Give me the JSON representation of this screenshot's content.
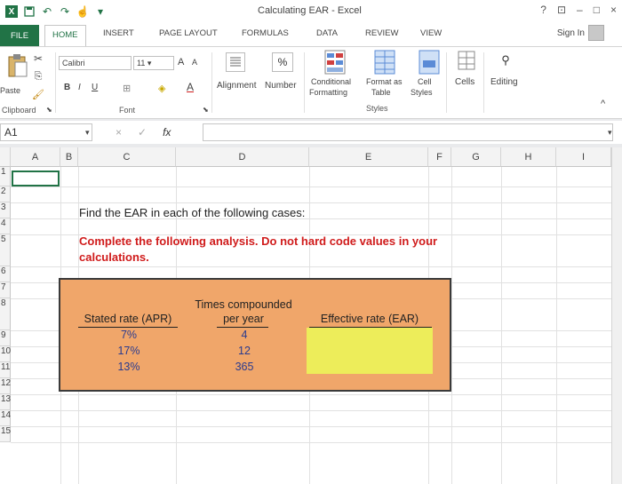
{
  "window": {
    "title": "Calculating EAR - Excel",
    "controls": [
      "?",
      "⊡",
      "–",
      "□",
      "×"
    ],
    "qat_icons": [
      "excel-logo-icon",
      "save-icon",
      "undo-icon",
      "redo-icon",
      "customize-icon"
    ]
  },
  "tabs": [
    "FILE",
    "HOME",
    "INSERT",
    "PAGE LAYOUT",
    "FORMULAS",
    "DATA",
    "REVIEW",
    "VIEW"
  ],
  "sign_in": "Sign In",
  "ribbon": {
    "clipboard": {
      "paste": "Paste",
      "label": "Clipboard"
    },
    "font": {
      "name": "Calibri",
      "size": "11",
      "bold": "B",
      "italic": "I",
      "underline": "U",
      "grow": "A",
      "shrink": "A",
      "color_a": "A",
      "label": "Font"
    },
    "alignment": "Alignment",
    "number": {
      "symbol": "%",
      "label": "Number"
    },
    "styles": {
      "conditional_line1": "Conditional",
      "conditional_line2": "Formatting",
      "format_table_line1": "Format as",
      "format_table_line2": "Table",
      "cell_styles_line1": "Cell",
      "cell_styles_line2": "Styles",
      "label": "Styles"
    },
    "cells": "Cells",
    "editing": "Editing"
  },
  "formula_bar": {
    "name_box": "A1",
    "cancel": "×",
    "enter": "✓",
    "fx": "fx",
    "value": ""
  },
  "columns": [
    "A",
    "B",
    "C",
    "D",
    "E",
    "F",
    "G",
    "H",
    "I"
  ],
  "rows": [
    "1",
    "2",
    "3",
    "4",
    "5",
    "6",
    "7",
    "8",
    "9",
    "10",
    "11",
    "12",
    "13",
    "14",
    "15"
  ],
  "sheet": {
    "question": "Find the EAR in each of the following cases:",
    "instruction_line1": "Complete the following analysis. Do not hard code values in your",
    "instruction_line2": "calculations.",
    "table": {
      "headers": {
        "stated_rate": "Stated rate (APR)",
        "times_line1": "Times compounded",
        "times_line2": "per year",
        "effective": "Effective rate (EAR)"
      },
      "rows": [
        {
          "apr": "7%",
          "times": "4",
          "ear": ""
        },
        {
          "apr": "17%",
          "times": "12",
          "ear": ""
        },
        {
          "apr": "13%",
          "times": "365",
          "ear": ""
        }
      ]
    }
  },
  "colors": {
    "excel_green": "#217346",
    "table_fill": "#f0a66a",
    "answer_fill": "#eded5a",
    "instruction_red": "#d01c1c",
    "value_blue": "#2a3b8f"
  }
}
